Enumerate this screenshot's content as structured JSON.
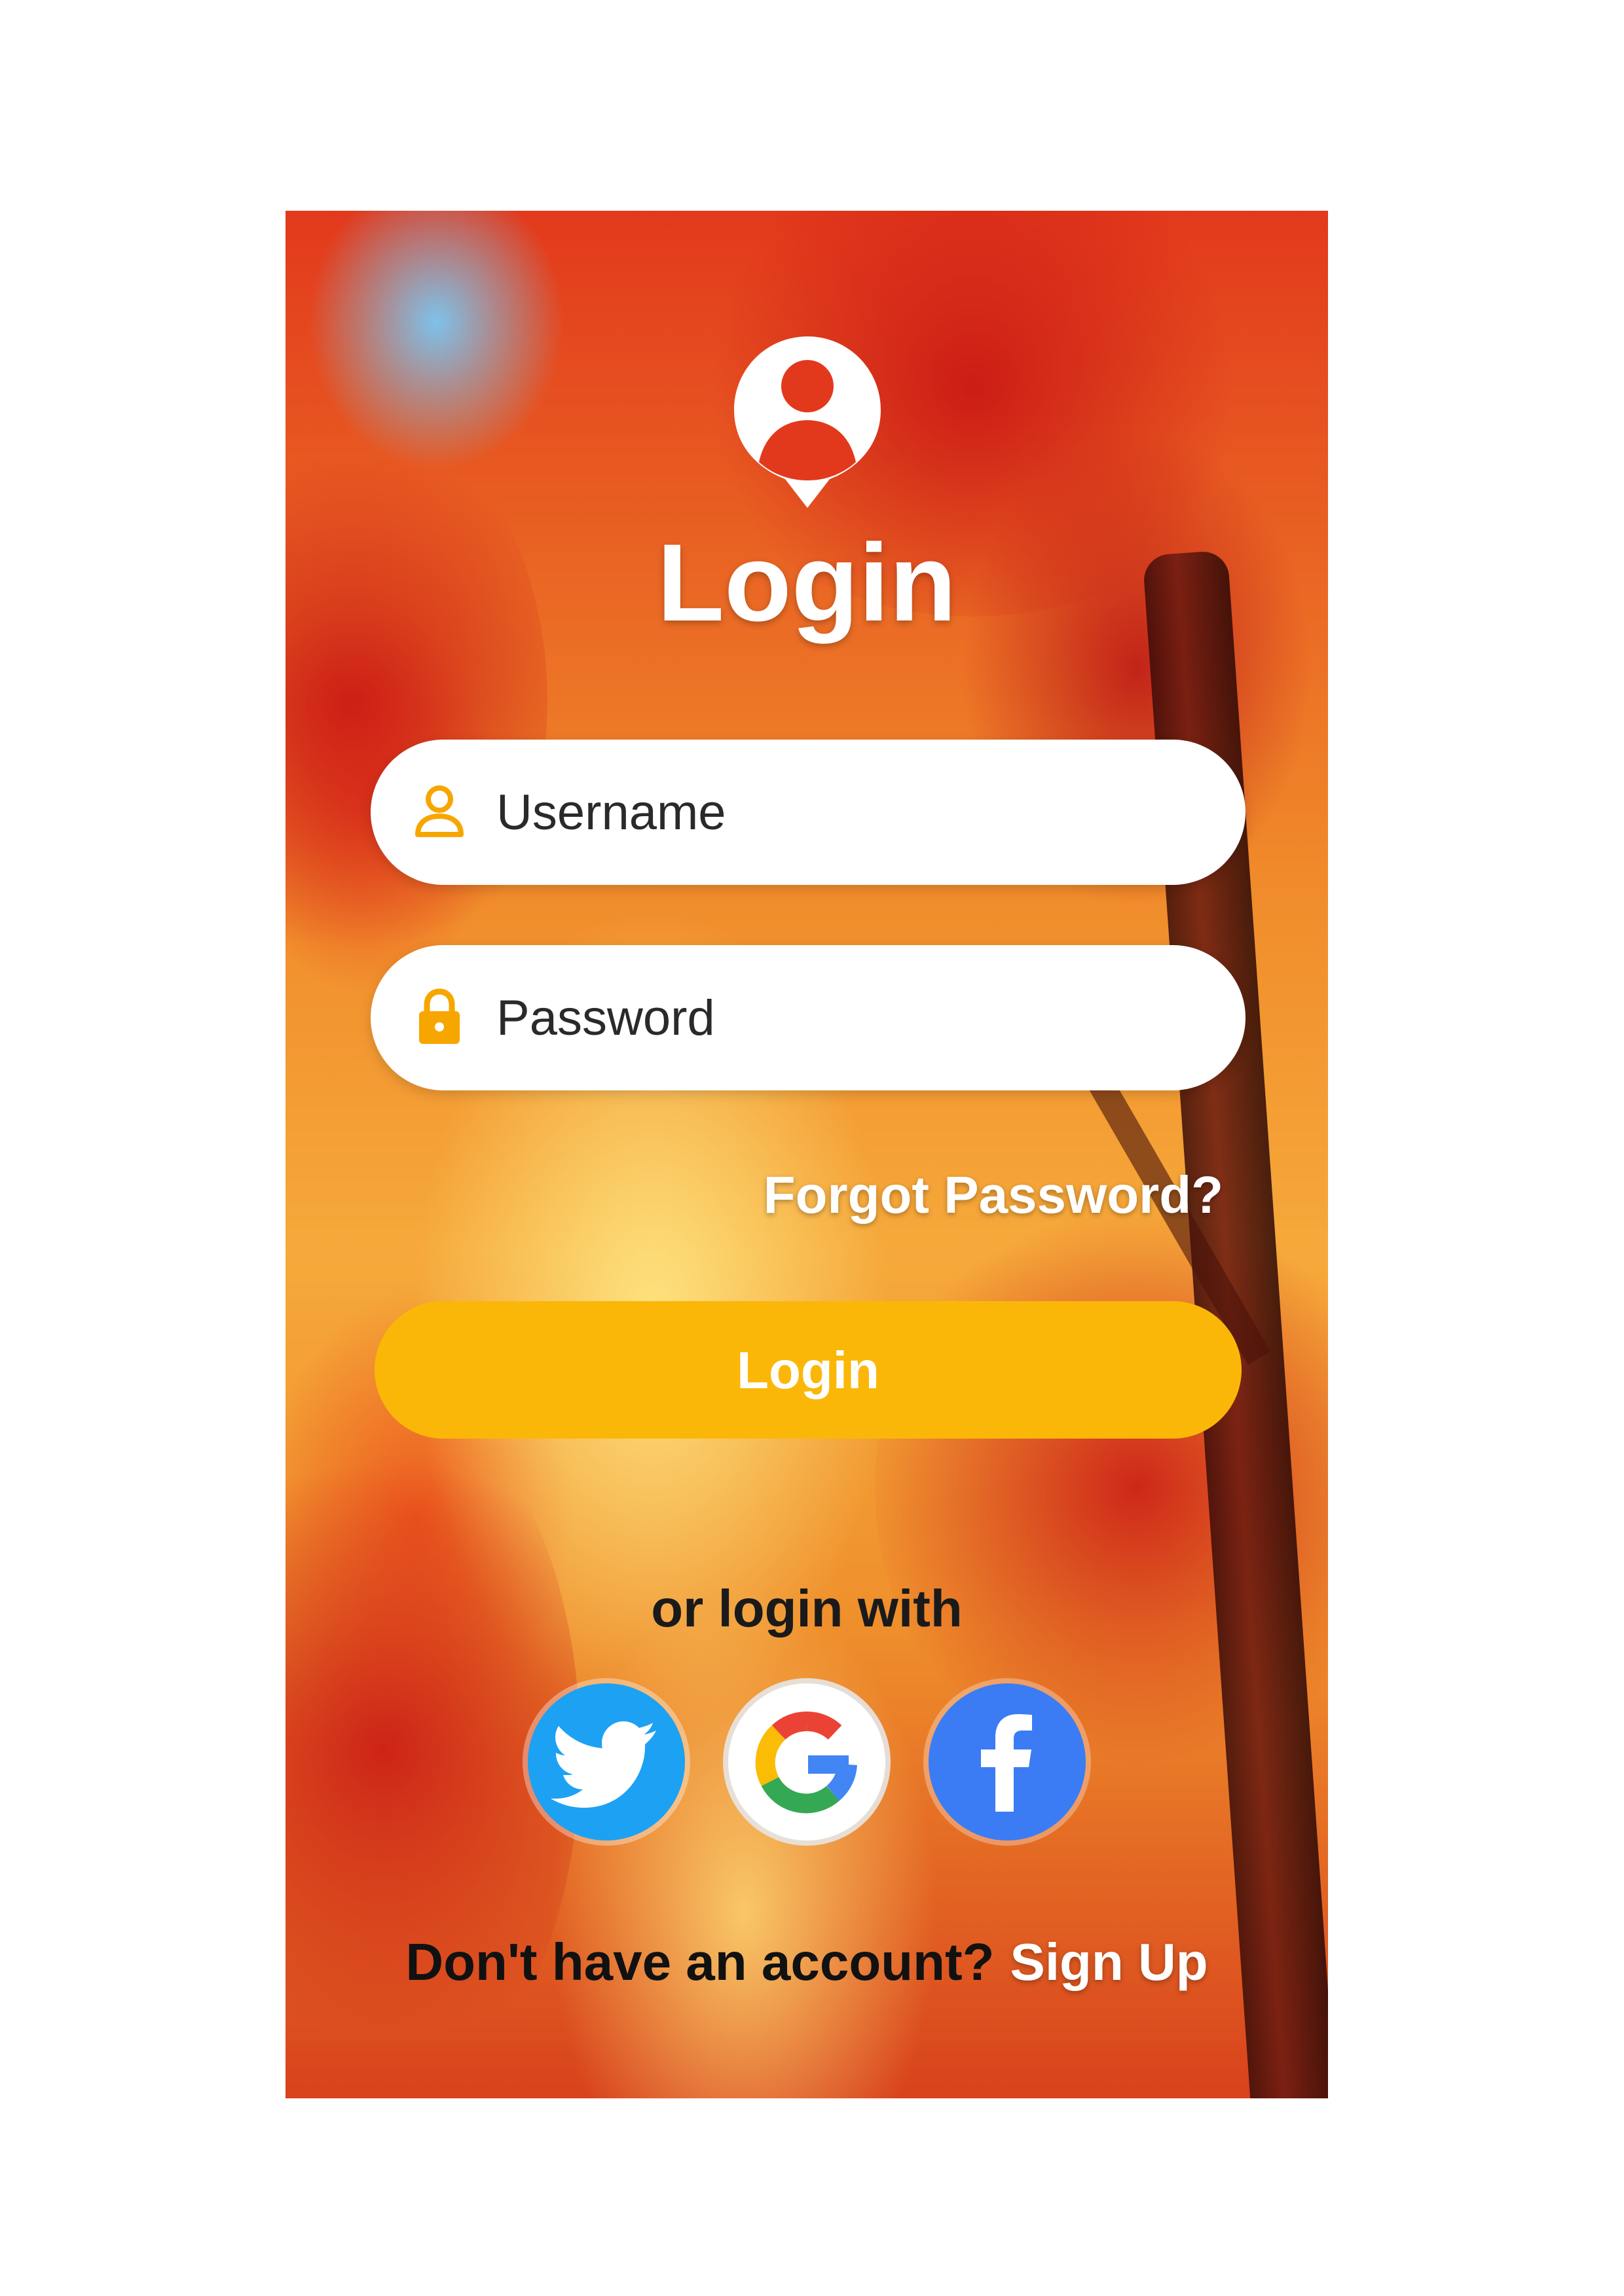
{
  "screen": {
    "title": "Login"
  },
  "form": {
    "username_placeholder": "Username",
    "password_placeholder": "Password",
    "forgot_label": "Forgot Password?",
    "login_button_label": "Login"
  },
  "social": {
    "prompt": "or login with",
    "providers": [
      {
        "name": "twitter-icon",
        "color": "#1da1f2"
      },
      {
        "name": "google-icon",
        "color": "#ffffff"
      },
      {
        "name": "facebook-icon",
        "color": "#3b7cf5"
      }
    ]
  },
  "signup": {
    "question": "Don't have an account?",
    "link_label": "Sign Up"
  },
  "colors": {
    "accent": "#fbb708",
    "icon_orange": "#f7a600"
  }
}
